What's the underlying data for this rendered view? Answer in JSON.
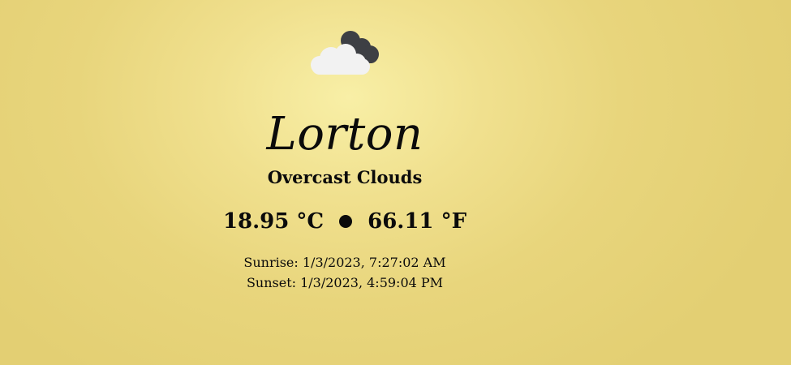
{
  "weather": {
    "icon": "overcast-clouds-icon",
    "city": "Lorton",
    "condition": "Overcast Clouds",
    "temp_c": "18.95 °C",
    "temp_f": "66.11 °F",
    "sunrise": "Sunrise: 1/3/2023, 7:27:02 AM",
    "sunset": "Sunset: 1/3/2023, 4:59:04 PM"
  },
  "colors": {
    "background_center": "#f8efa6",
    "background_edge": "#e3cf73",
    "text": "#0b0b0b",
    "cloud_front": "#f2f2f2",
    "cloud_back": "#3d3f44"
  }
}
